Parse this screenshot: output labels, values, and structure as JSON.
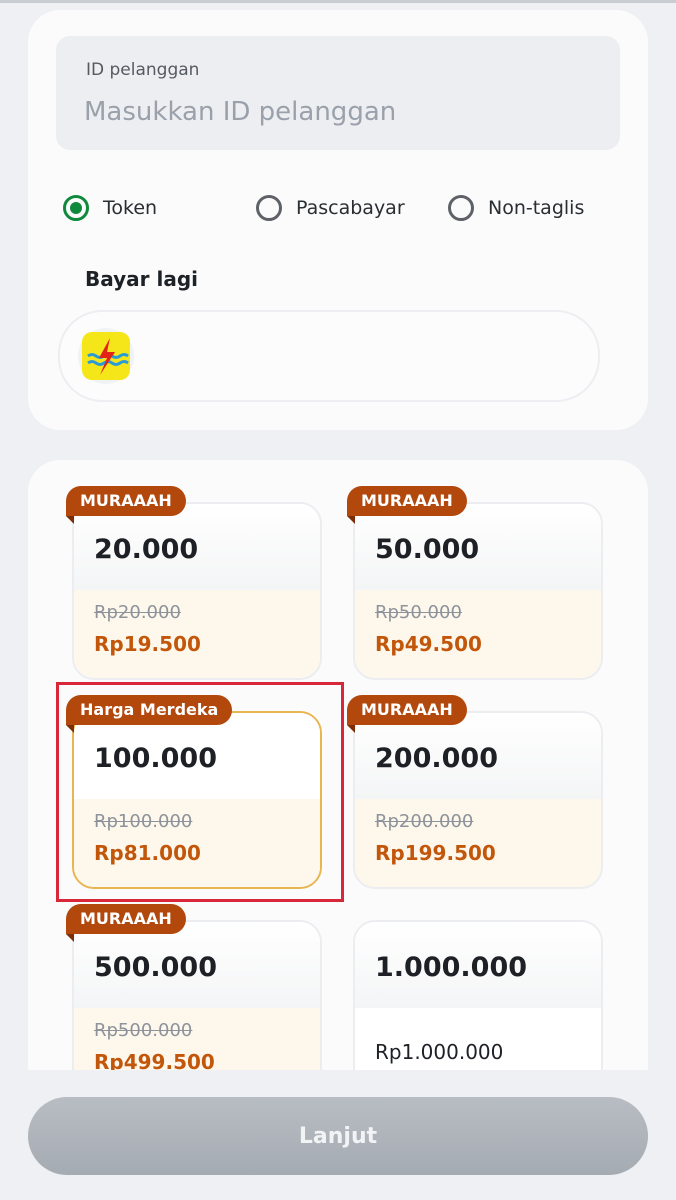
{
  "customer": {
    "id_label": "ID pelanggan",
    "id_placeholder": "Masukkan ID pelanggan",
    "id_value": ""
  },
  "payment_types": [
    {
      "label": "Token",
      "selected": true
    },
    {
      "label": "Pascabayar",
      "selected": false
    },
    {
      "label": "Non-taglis",
      "selected": false
    }
  ],
  "recent": {
    "title": "Bayar lagi",
    "items": [
      {
        "icon": "pln-logo-icon"
      }
    ]
  },
  "products": [
    {
      "badge": "MURAAAH",
      "amount": "20.000",
      "original_price": "Rp20.000",
      "price": "Rp19.500",
      "selected": false
    },
    {
      "badge": "MURAAAH",
      "amount": "50.000",
      "original_price": "Rp50.000",
      "price": "Rp49.500",
      "selected": false
    },
    {
      "badge": "Harga Merdeka",
      "amount": "100.000",
      "original_price": "Rp100.000",
      "price": "Rp81.000",
      "selected": true
    },
    {
      "badge": "MURAAAH",
      "amount": "200.000",
      "original_price": "Rp200.000",
      "price": "Rp199.500",
      "selected": false
    },
    {
      "badge": "MURAAAH",
      "amount": "500.000",
      "original_price": "Rp500.000",
      "price": "Rp499.500",
      "selected": false
    },
    {
      "badge": "",
      "amount": "1.000.000",
      "original_price": "",
      "price": "Rp1.000.000",
      "selected": false
    }
  ],
  "colors": {
    "radio_selected": "#0f8a3c",
    "badge": "#b3480d",
    "discount_price": "#c2570c",
    "highlight": "#d8263a",
    "selected_border": "#e8b651"
  },
  "footer": {
    "continue_label": "Lanjut"
  }
}
